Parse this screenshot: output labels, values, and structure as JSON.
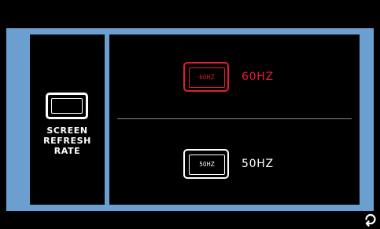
{
  "panel": {
    "title_lines": [
      "SCREEN",
      "REFRESH",
      "RATE"
    ],
    "icon": "screen-icon"
  },
  "options": [
    {
      "badge_text": "60HZ",
      "label": "60HZ",
      "selected": true
    },
    {
      "badge_text": "50HZ",
      "label": "50HZ",
      "selected": false
    }
  ],
  "footer": {
    "back_icon": "back-icon"
  },
  "colors": {
    "frame": "#6b9fd0",
    "selected": "#e01e32",
    "default": "#ffffff",
    "background": "#000000"
  }
}
